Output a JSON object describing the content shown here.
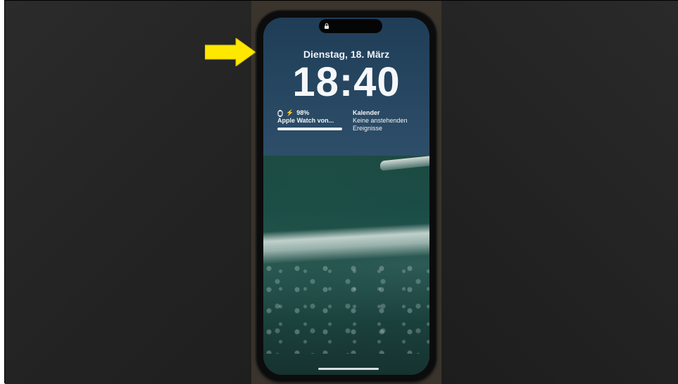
{
  "lockscreen": {
    "date": "Dienstag, 18. März",
    "time": "18:40",
    "watch_widget": {
      "battery": "98%",
      "charging_symbol": "⚡",
      "device_label": "Apple Watch von...",
      "battery_level": 0.98
    },
    "calendar_widget": {
      "title": "Kalender",
      "line1": "Keine anstehenden",
      "line2": "Ereignisse"
    }
  },
  "colors": {
    "arrow": "#ffe800",
    "background": "#252525"
  },
  "icons": [
    "lock-icon",
    "watch-icon",
    "arrow-icon"
  ]
}
